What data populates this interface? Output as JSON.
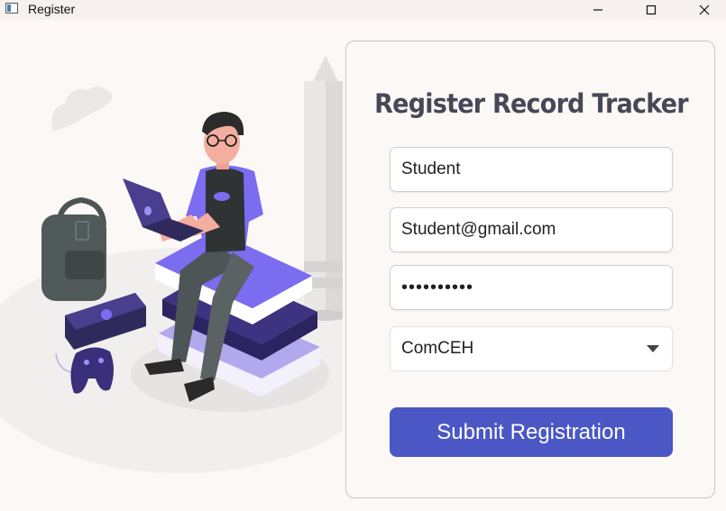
{
  "window": {
    "title": "Register",
    "icons": [
      "app-icon",
      "minimize-icon",
      "maximize-icon",
      "close-icon"
    ]
  },
  "form": {
    "title": "Register Record Tracker",
    "name_value": "Student",
    "email_value": "Student@gmail.com",
    "password_value": "••••••••••",
    "course_selected": "ComCEH",
    "submit_label": "Submit Registration"
  },
  "colors": {
    "accent": "#4a57c4",
    "background": "#fcf8f5",
    "title_text": "#474757",
    "illustration_purple": "#7b6cf0"
  }
}
